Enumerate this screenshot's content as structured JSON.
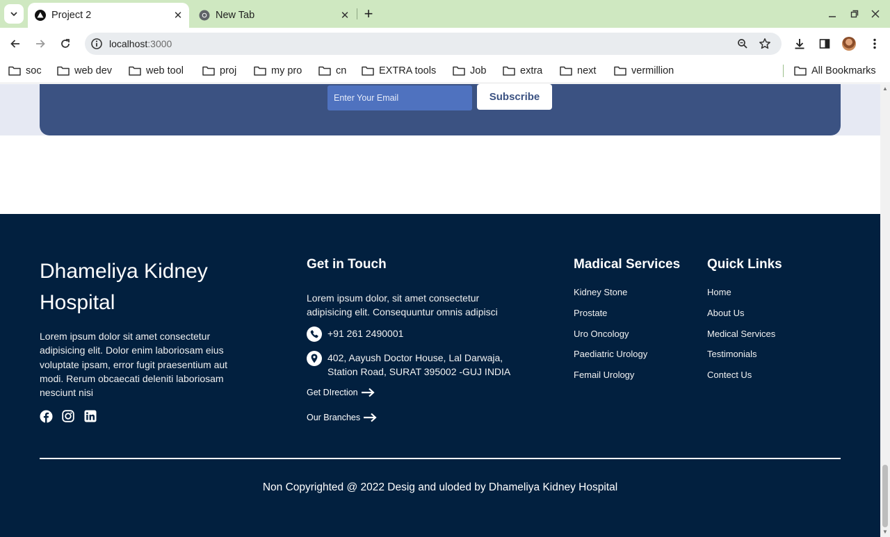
{
  "browser": {
    "tabs": [
      {
        "title": "Project 2",
        "active": true
      },
      {
        "title": "New Tab",
        "active": false
      }
    ],
    "address": {
      "host": "localhost",
      "port": ":3000"
    },
    "bookmarks": [
      "soc",
      "web dev",
      "web tool",
      "proj",
      "my pro",
      "cn",
      "EXTRA tools",
      "Job",
      "extra",
      "next",
      "vermillion"
    ],
    "all_bookmarks": "All Bookmarks"
  },
  "newsletter": {
    "email_placeholder": "Enter Your Email",
    "subscribe_label": "Subscribe"
  },
  "footer": {
    "brand": "Dhameliya Kidney Hospital",
    "brand_description": "Lorem ipsum dolor sit amet consectetur adipisicing elit. Dolor enim laboriosam eius voluptate ipsam, error fugit praesentium aut modi. Rerum obcaecati deleniti laboriosam nesciunt nisi",
    "social": [
      "facebook-icon",
      "instagram-icon",
      "linkedin-icon"
    ],
    "contact": {
      "title": "Get in Touch",
      "description": "Lorem ipsum dolor, sit amet consectetur adipisicing elit. Consequuntur omnis adipisci",
      "phone": "+91 261 2490001",
      "address": "402, Aayush Doctor House, Lal Darwaja, Station Road, SURAT 395002 -GUJ INDIA",
      "get_direction": "Get DIrection",
      "our_branches": "Our Branches"
    },
    "services": {
      "title": "Madical Services",
      "items": [
        "Kidney Stone",
        "Prostate",
        "Uro Oncology",
        "Paediatric Urology",
        "Femail Urology"
      ]
    },
    "quick_links": {
      "title": "Quick Links",
      "items": [
        "Home",
        "About Us",
        "Medical Services",
        "Testimonials",
        "Contect Us"
      ]
    },
    "copyright": "Non Copyrighted @ 2022 Desig and uloded by Dhameliya Kidney Hospital"
  },
  "colors": {
    "tab_strip": "#cfe8c1",
    "newsletter_bg": "#3b5282",
    "email_input_bg": "#4f72bf",
    "footer_bg": "#02203f"
  }
}
